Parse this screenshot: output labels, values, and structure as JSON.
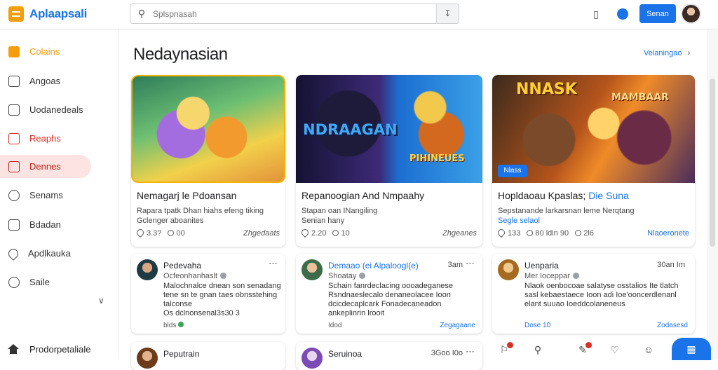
{
  "app": {
    "logo_text": "Aplaapsali"
  },
  "search": {
    "placeholder": "Splspnasah",
    "value": ""
  },
  "header": {
    "signin_label": "Senan"
  },
  "sidebar": {
    "items": [
      {
        "label": "Colains",
        "icon": "app-icon"
      },
      {
        "label": "Angoas",
        "icon": "square-icon"
      },
      {
        "label": "Uodanedeals",
        "icon": "square-icon"
      },
      {
        "label": "Reaphs",
        "icon": "puzzle-icon"
      },
      {
        "label": "Dennes",
        "icon": "square-icon"
      },
      {
        "label": "Senams",
        "icon": "share-icon"
      },
      {
        "label": "Bdadan",
        "icon": "bookmark-icon"
      },
      {
        "label": "Apdlkauka",
        "icon": "pin-icon"
      },
      {
        "label": "Saile",
        "icon": "search-icon"
      }
    ],
    "bottom_label": "Prodorpetaliale"
  },
  "main": {
    "section_title": "Nedaynasian",
    "see_all": "Velaningao",
    "cards": [
      {
        "title": "Nemagarj le Pdoansan",
        "desc_line1": "Rapara tpatk Dhan hiahs efeng tiking",
        "desc_line2": "Gclenger aboanites",
        "likes": "3.3?",
        "comments": "00",
        "meta_right": "Zhgedaats"
      },
      {
        "thumb_text": "NDRAAGAN",
        "thumb_text2": "PIHINEUES",
        "title": "Repanoogian And Nmpaahy",
        "desc_line1": "Stapan oan INangiling",
        "desc_line2": "Senian hany",
        "likes": "2.20",
        "comments": "10",
        "meta_right": "Zhgeanes"
      },
      {
        "thumb_text": "NNASK",
        "thumb_text2": "MAMBAAR",
        "badge": "Nlass",
        "title_prefix": "Hopldaoau Kpaslas;",
        "title_link": "Die Suna",
        "desc_line1": "Sepstanande larkarsnan leme Nerqtang",
        "desc_link": "Segle selaol",
        "likes": "133",
        "comments": "80 ldin 90",
        "extra": "2l6",
        "meta_right": "Nlaoeronete"
      }
    ],
    "posts": [
      {
        "name": "Pedevaha",
        "sub": "Ocfeonhanhaslt",
        "time": "",
        "body": "Malochnalce dnean son senadang tene sn te gnan taes obnsstehing talconse",
        "body2": "Os dclnonsenal3s30 3",
        "foot": "blds"
      },
      {
        "name": "Demaao (ei Alpaloogl(e)",
        "sub": "Shoatay",
        "time": "3am",
        "body": "Schain fanrdeclacing oooadeganese Rsndnaeslecalo denaneolacee Ioon dcicdecaplcark Fonadecaneadon ankeplinrin lrooit",
        "body2": "",
        "foot": "Idod",
        "foot_right": "Zegagaane"
      },
      {
        "name": "Uenparia",
        "sub": "Mer Ioceppar",
        "time": "30an Im",
        "body": "Nlaok oenbocoae salatyse osstalios Ite tlatch sasl kebaestaece Ioon adi Ioe'ooncerdlenanl elant suuao Ioeddcolaneneus",
        "body2": "",
        "foot": "Dose 10",
        "foot_right": "Zodasesd"
      }
    ],
    "posts_bottom": [
      {
        "name": "Peputrain"
      },
      {
        "name": "Seruinoa",
        "time": "3Goo I0o"
      }
    ]
  },
  "colors": {
    "accent": "#1a73e8",
    "orange": "#f59e0b",
    "red": "#d93025",
    "selected_bg": "#fde3e1"
  }
}
